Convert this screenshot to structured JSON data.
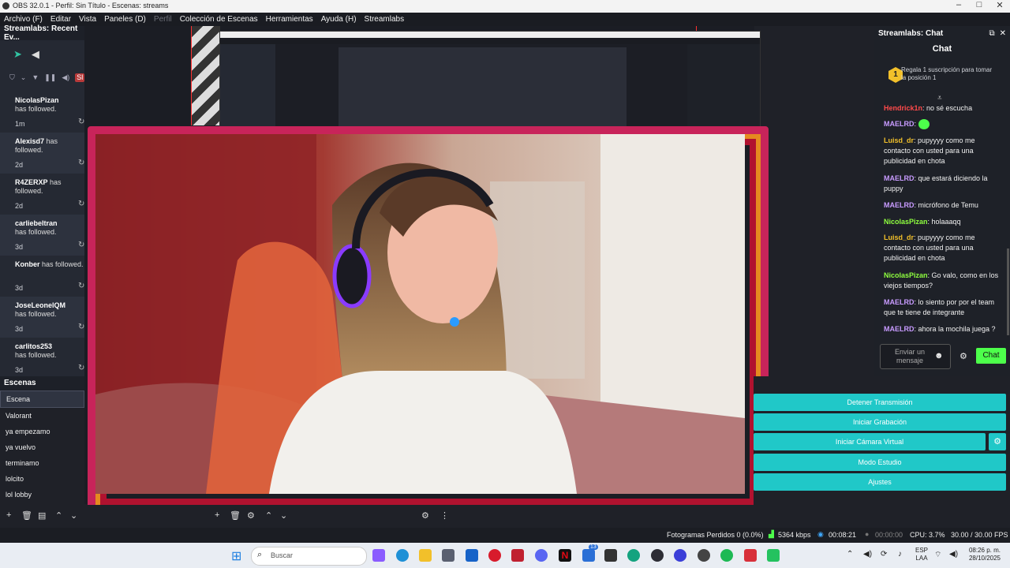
{
  "window": {
    "title": "OBS 32.0.1 - Perfil: Sin Título - Escenas: streams"
  },
  "menu": [
    "Archivo (F)",
    "Editar",
    "Vista",
    "Paneles (D)",
    "Perfil",
    "Colección de Escenas",
    "Herramientas",
    "Ayuda (H)",
    "Streamlabs"
  ],
  "left_dock": {
    "title": "Streamlabs: Recent Ev...",
    "live_label": "Sl",
    "events": [
      {
        "user": "NicolasPizan",
        "text": "has followed.",
        "time": "1m"
      },
      {
        "user": "Alexisd7",
        "text": "has followed.",
        "time": "2d"
      },
      {
        "user": "R4ZERXP",
        "text": "has followed.",
        "time": "2d"
      },
      {
        "user": "carliebeltran",
        "text": "has followed.",
        "time": "3d"
      },
      {
        "user": "Konber",
        "text": "has followed.",
        "time": "3d"
      },
      {
        "user": "JoseLeonelQM",
        "text": "has followed.",
        "time": "3d"
      },
      {
        "user": "carlitos253",
        "text": "has followed.",
        "time": "3d"
      }
    ]
  },
  "chat": {
    "dock_title": "Streamlabs: Chat",
    "title": "Chat",
    "goal_number": "1",
    "goal_text": "Regala 1 suscripción para tomar la posición 1",
    "messages": [
      {
        "user": "Hendrick1n",
        "color": "#ff4a4a",
        "text": ": no sé escucha"
      },
      {
        "user": "MAELRD",
        "color": "#c89bff",
        "text": ":"
      },
      {
        "user": "Luisd_dr",
        "color": "#f2c02a",
        "text": ": pupyyyy como me contacto con usted para una publicidad en chota"
      },
      {
        "user": "MAELRD",
        "color": "#c89bff",
        "text": ": que estará diciendo la puppy"
      },
      {
        "user": "MAELRD",
        "color": "#c89bff",
        "text": ": micrófono de Temu"
      },
      {
        "user": "NicolasPizan",
        "color": "#8fff3f",
        "text": ": holaaaqq"
      },
      {
        "user": "Luisd_dr",
        "color": "#f2c02a",
        "text": ": pupyyyy como me contacto con usted para una publicidad en chota"
      },
      {
        "user": "NicolasPizan",
        "color": "#8fff3f",
        "text": ": Go valo, como en los viejos tiempos?"
      },
      {
        "user": "MAELRD",
        "color": "#c89bff",
        "text": ": lo siento por por el team que te tiene de integrante"
      },
      {
        "user": "MAELRD",
        "color": "#c89bff",
        "text": ": ahora la mochila juega ?"
      }
    ],
    "input_placeholder": "Enviar un mensaje",
    "send_label": "Chat"
  },
  "scenes": {
    "title": "Escenas",
    "items": [
      "Escena",
      "Valorant",
      "ya empezamo",
      "ya vuelvo",
      "terminamo",
      "lolcito",
      "lol lobby"
    ]
  },
  "controls": {
    "stop_stream": "Detener Transmisión",
    "start_recording": "Iniciar Grabación",
    "start_virtual_cam": "Iniciar Cámara Virtual",
    "studio_mode": "Modo Estudio",
    "settings": "Ajustes"
  },
  "status": {
    "dropped_frames": "Fotogramas Perdidos 0 (0.0%)",
    "bitrate": "5364 kbps",
    "stream_time": "00:08:21",
    "rec_time": "00:00:00",
    "cpu": "CPU: 3.7%",
    "fps": "30.00 / 30.00 FPS"
  },
  "taskbar": {
    "search_placeholder": "Buscar",
    "lang": "ESP",
    "lang2": "LAA",
    "time": "08:26 p. m.",
    "date": "28/10/2025",
    "badge1": "13"
  },
  "colors": {
    "accent": "#20c8c8",
    "chat_send": "#4dff4b"
  }
}
